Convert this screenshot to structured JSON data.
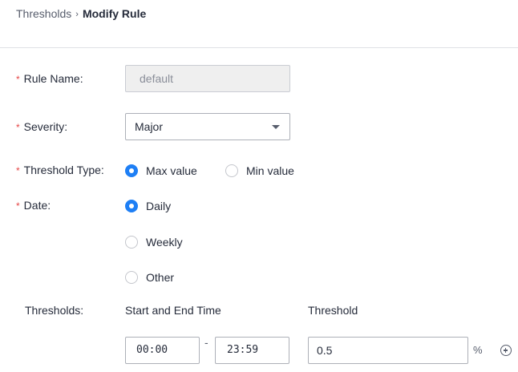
{
  "breadcrumb": {
    "parent": "Thresholds",
    "separator": "›",
    "current": "Modify Rule"
  },
  "form": {
    "required_mark": "*",
    "rule_name": {
      "label": "Rule Name:",
      "value": "default"
    },
    "severity": {
      "label": "Severity:",
      "value": "Major"
    },
    "threshold_type": {
      "label": "Threshold Type:",
      "options": [
        {
          "label": "Max value",
          "checked": true
        },
        {
          "label": "Min value",
          "checked": false
        }
      ]
    },
    "date": {
      "label": "Date:",
      "options": [
        {
          "label": "Daily",
          "checked": true
        },
        {
          "label": "Weekly",
          "checked": false
        },
        {
          "label": "Other",
          "checked": false
        }
      ]
    },
    "thresholds": {
      "label": "Thresholds:",
      "col_time": "Start and End Time",
      "col_threshold": "Threshold",
      "start_time": "00:00",
      "range_sep": "-",
      "end_time": "23:59",
      "threshold_value": "0.5",
      "unit": "%"
    }
  },
  "colors": {
    "accent": "#1e7ff5",
    "required": "#e54545"
  }
}
